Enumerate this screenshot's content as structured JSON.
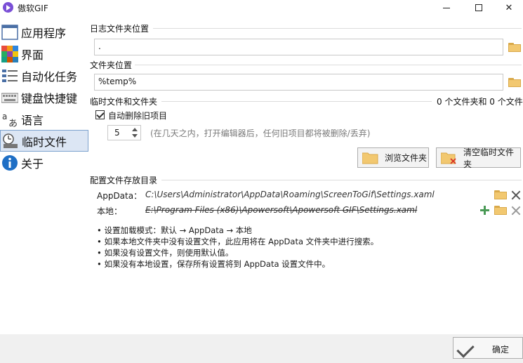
{
  "window": {
    "title": "傲软GIF",
    "icon": "play-icon",
    "accent": "#7a4fd6"
  },
  "sidebar": {
    "items": [
      {
        "label": "应用程序",
        "icon": "window-icon"
      },
      {
        "label": "界面",
        "icon": "palette-grid-icon"
      },
      {
        "label": "自动化任务",
        "icon": "list-icon"
      },
      {
        "label": "键盘快捷键",
        "icon": "keyboard-icon"
      },
      {
        "label": "语言",
        "icon": "language-icon"
      },
      {
        "label": "临时文件",
        "icon": "temp-file-icon",
        "active": true
      },
      {
        "label": "关于",
        "icon": "info-icon"
      }
    ],
    "active_color": "#dce6f4"
  },
  "logs": {
    "title": "日志文件夹位置",
    "value": "."
  },
  "folder": {
    "title": "文件夹位置",
    "value": "%temp%"
  },
  "temp": {
    "title": "临时文件和文件夹",
    "count_text": "0 个文件夹和 0 个文件",
    "auto_delete_label": "自动删除旧项目",
    "auto_delete_checked": true,
    "days_value": "5",
    "days_hint": "(在几天之内，打开编辑器后，任何旧项目都将被删除/丢弃)",
    "browse_label": "浏览文件夹",
    "clear_label": "清空临时文件夹"
  },
  "config": {
    "title": "配置文件存放目录",
    "appdata_label": "AppData：",
    "appdata_path": "C:\\Users\\Administrator\\AppData\\Roaming\\ScreenToGif\\Settings.xaml",
    "local_label": "本地：",
    "local_path": "E:\\Program Files (x86)\\Apowersoft\\Apowersoft GIF\\Settings.xaml",
    "notes": [
      "• 设置加载模式：默认 → AppData → 本地",
      "• 如果本地文件夹中没有设置文件，此应用将在 AppData 文件夹中进行搜索。",
      "• 如果没有设置文件，则使用默认值。",
      "• 如果没有本地设置，保存所有设置将到 AppData 设置文件中。"
    ]
  },
  "footer": {
    "ok_label": "确定"
  }
}
